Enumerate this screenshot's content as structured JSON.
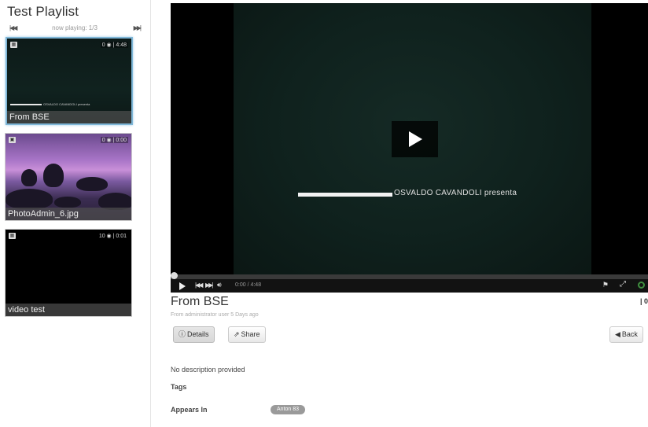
{
  "playlist": {
    "title": "Test Playlist",
    "now_playing": "now playing: 1/3",
    "items": [
      {
        "caption": "From BSE",
        "stats": "0 ◉ | 4:48",
        "overlay": "OSVALDO CAVANDOLI presenta"
      },
      {
        "caption": "PhotoAdmin_6.jpg",
        "stats": "0 ◉ | 0:00"
      },
      {
        "caption": "video test",
        "stats": "10 ◉ | 0:01"
      }
    ]
  },
  "player": {
    "overlay_text": "OSVALDO CAVANDOLI presenta",
    "time": "0:00 / 4:48",
    "progress": 0
  },
  "video": {
    "title": "From BSE",
    "counter": "| 0",
    "meta": "From administrator user 5 Days ago",
    "details_label": "Details",
    "share_label": "Share",
    "back_label": "Back",
    "description": "No description provided",
    "tags_label": "Tags",
    "appears_in_label": "Appears In",
    "appears_in_chip": "Anton 83"
  },
  "icons": {
    "skip_prev": "skip-previous-icon",
    "skip_next": "skip-next-icon",
    "details": "info-icon",
    "share": "share-icon",
    "back": "arrow-left-icon"
  }
}
